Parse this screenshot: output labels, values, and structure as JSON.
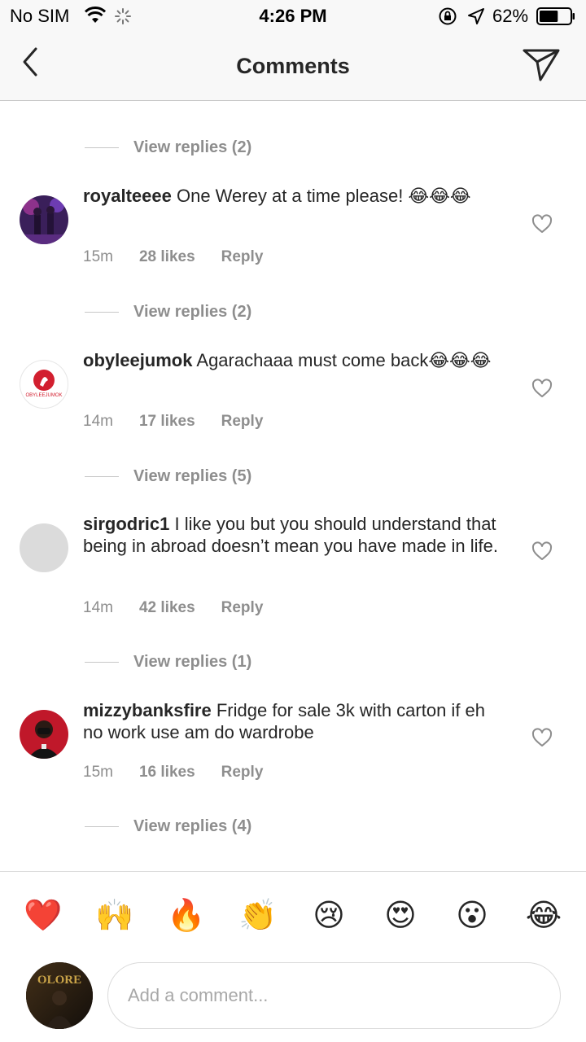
{
  "status_bar": {
    "carrier": "No SIM",
    "time": "4:26 PM",
    "battery": "62%",
    "battery_level": 0.62
  },
  "nav": {
    "title": "Comments",
    "back_icon": "chevron-left-icon",
    "send_icon": "paper-plane-icon"
  },
  "replies_labels": [
    "View replies (2)",
    "View replies (2)",
    "View replies (5)",
    "View replies (1)",
    "View replies (4)"
  ],
  "comments": [
    {
      "username": "royalteeee",
      "text": "One Werey at a time please! 😂😂😂",
      "time": "15m",
      "likes": "28 likes",
      "reply": "Reply"
    },
    {
      "username": "obyleejumok",
      "text": "Agarachaaa must come back😂😂😂",
      "time": "14m",
      "likes": "17 likes",
      "reply": "Reply",
      "avatar_logo_text": "OBYLEEJUMOK"
    },
    {
      "username": "sirgodric1",
      "text": "I like you but you should understand that being in abroad doesn’t mean you have made in life.",
      "time": "14m",
      "likes": "42 likes",
      "reply": "Reply"
    },
    {
      "username": "mizzybanksfire",
      "text": "Fridge for sale 3k with carton if eh no work use am do wardrobe",
      "time": "15m",
      "likes": "16 likes",
      "reply": "Reply"
    }
  ],
  "emoji_bar": [
    "❤️",
    "🙌",
    "🔥",
    "👏",
    "😢",
    "😍",
    "😮",
    "😂"
  ],
  "input": {
    "placeholder": "Add a comment...",
    "value": "",
    "avatar_logo_text": "OLORE"
  },
  "colors": {
    "text": "#262626",
    "secondary": "#8e8e8e",
    "border": "#dbdbdb",
    "bar_bg": "#f8f8f8"
  }
}
